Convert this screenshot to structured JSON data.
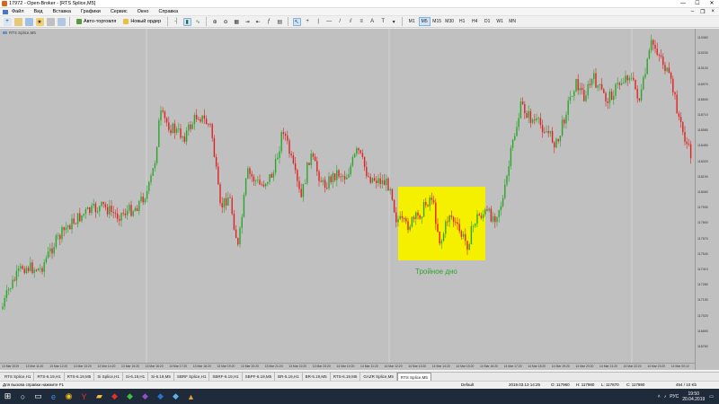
{
  "window": {
    "title": "17972 - Open-Broker - [RTS Splice,M5]",
    "minimize": "—",
    "maximize": "☐",
    "close": "✕"
  },
  "menu": {
    "items": [
      "Файл",
      "Вид",
      "Вставка",
      "Графики",
      "Сервис",
      "Окно",
      "Справка"
    ]
  },
  "toolbar": {
    "autotrade_label": "Авто-торговля",
    "neworder_label": "Новый ордер",
    "timeframes": [
      "M1",
      "M5",
      "M15",
      "M30",
      "H1",
      "H4",
      "D1",
      "W1",
      "MN"
    ],
    "active_timeframe": "M5"
  },
  "chart": {
    "label": "RTS Splice,M5",
    "annotation": "Тройное дно",
    "price_labels": [
      "119360",
      "119230",
      "119100",
      "118970",
      "118840",
      "118710",
      "118580",
      "118450",
      "118320",
      "118190",
      "118060",
      "117930",
      "117800",
      "117670",
      "117540",
      "117410",
      "117280",
      "117150",
      "117020",
      "116890",
      "116760"
    ],
    "time_labels": [
      "13 Mar 2019",
      "13 Mar 11:20",
      "13 Mar 12:20",
      "13 Mar 13:20",
      "13 Mar 14:20",
      "13 Mar 15:20",
      "13 Mar 16:20",
      "13 Mar 17:20",
      "13 Mar 18:20",
      "13 Mar 19:20",
      "13 Mar 20:20",
      "13 Mar 21:20",
      "13 Mar 22:20",
      "13 Mar 23:20",
      "14 Mar 10:20",
      "14 Mar 11:20",
      "14 Mar 12:20",
      "14 Mar 13:20",
      "14 Mar 14:20",
      "14 Mar 15:20",
      "14 Mar 16:20",
      "14 Mar 17:20",
      "14 Mar 18:20",
      "14 Mar 19:20",
      "14 Mar 20:20",
      "14 Mar 21:20",
      "14 Mar 22:20",
      "14 Mar 23:20",
      "14 Mar 00:10"
    ],
    "up_color": "#2aa52a",
    "down_color": "#e02020",
    "highlight_color": "#f5f000"
  },
  "tabs": {
    "items": [
      "RTS Splice,H1",
      "RTS-6.19,H1",
      "RTS-6.19,M5",
      "Si Splice,H1",
      "Si-6.19,H1",
      "Si-6.19,M5",
      "SBRF Splice,H1",
      "SBRF-6.19,H1",
      "SBPF-6.19,M5",
      "BR-5.19,H1",
      "BR-5.19,M5",
      "RTS-6.19,M5",
      "GAZR Splice,M5",
      "RTS Splice,M5"
    ],
    "active": "RTS Splice,M5"
  },
  "status": {
    "help": "Для вызова справки нажмите F1",
    "profile": "Default",
    "datetime": "2019.03.13 14:25",
    "open": "O: 117960",
    "high": "H: 117980",
    "low": "L: 117870",
    "close": "C: 117890",
    "traffic": "454 / 10 Kb"
  },
  "taskbar": {
    "lang": "РУС",
    "time": "19:50",
    "date": "20.04.2019"
  }
}
